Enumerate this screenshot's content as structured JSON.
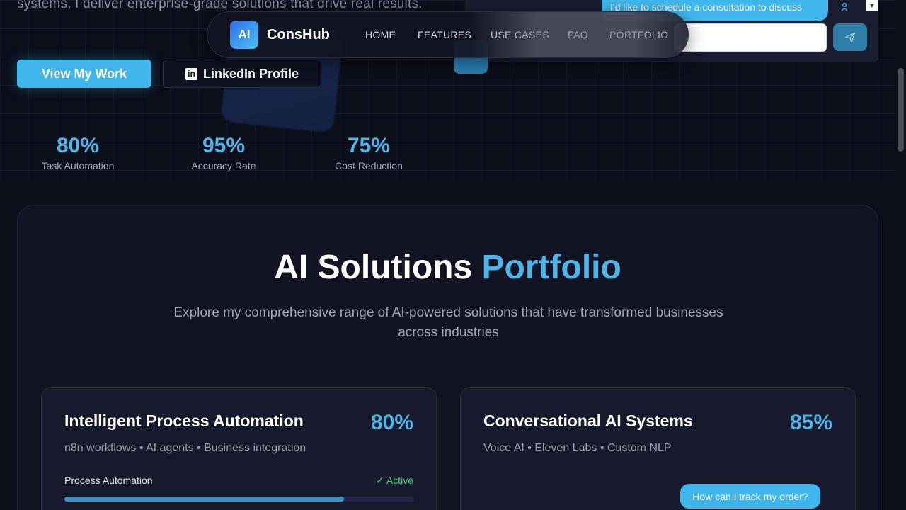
{
  "hero": {
    "description": "systems, I deliver enterprise-grade solutions that drive real results.",
    "primary_button": "View My Work",
    "secondary_button": "LinkedIn Profile",
    "stats": [
      {
        "value": "80%",
        "label": "Task Automation"
      },
      {
        "value": "95%",
        "label": "Accuracy Rate"
      },
      {
        "value": "75%",
        "label": "Cost Reduction"
      }
    ]
  },
  "chat": {
    "partial_message": "I'd like to schedule a consultation to discuss",
    "input_placeholder": "",
    "floating_suggestion": "How can I track my order?"
  },
  "navbar": {
    "logo_badge": "AI",
    "brand": "ConsHub",
    "links": [
      "HOME",
      "FEATURES",
      "USE CASES",
      "FAQ",
      "PORTFOLIO"
    ]
  },
  "portfolio": {
    "title_main": "AI Solutions",
    "title_accent": "Portfolio",
    "subtitle": "Explore my comprehensive range of AI-powered solutions that have transformed businesses across industries",
    "cards": [
      {
        "title": "Intelligent Process Automation",
        "percent": "80%",
        "tags": "n8n workflows • AI agents • Business integration",
        "row_label": "Process Automation",
        "status": "✓ Active",
        "progress": 0.8
      },
      {
        "title": "Conversational AI Systems",
        "percent": "85%",
        "tags": "Voice AI • Eleven Labs • Custom NLP"
      }
    ]
  },
  "colors": {
    "accent": "#4cb6ea",
    "background": "#0c0e19",
    "active_status": "#3fd07a"
  }
}
